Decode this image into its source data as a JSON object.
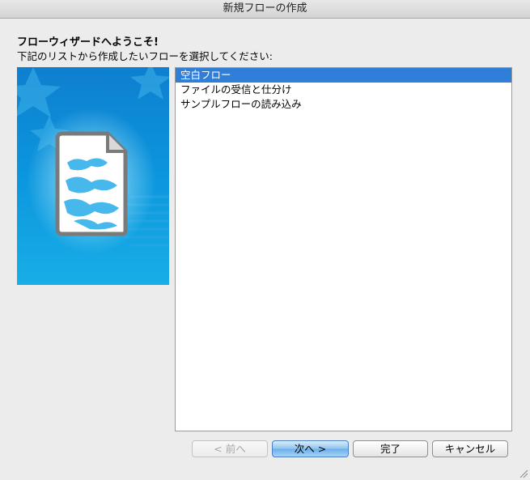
{
  "window": {
    "title": "新規フローの作成"
  },
  "wizard": {
    "heading": "フローウィザードへようこそ!",
    "instruction": "下記のリストから作成したいフローを選択してください:"
  },
  "flow_list": {
    "selected_index": 0,
    "items": [
      {
        "label": "空白フロー"
      },
      {
        "label": "ファイルの受信と仕分け"
      },
      {
        "label": "サンプルフローの読み込み"
      }
    ]
  },
  "buttons": {
    "back": "< 前へ",
    "next": "次へ >",
    "finish": "完了",
    "cancel": "キャンセル"
  },
  "colors": {
    "selection": "#2f7ed8",
    "image_background": "#0a8fd8",
    "default_button": "#6aafe9"
  },
  "icons": {
    "side_image": "document-with-globe-illustration",
    "resize": "resize-grip-icon"
  }
}
